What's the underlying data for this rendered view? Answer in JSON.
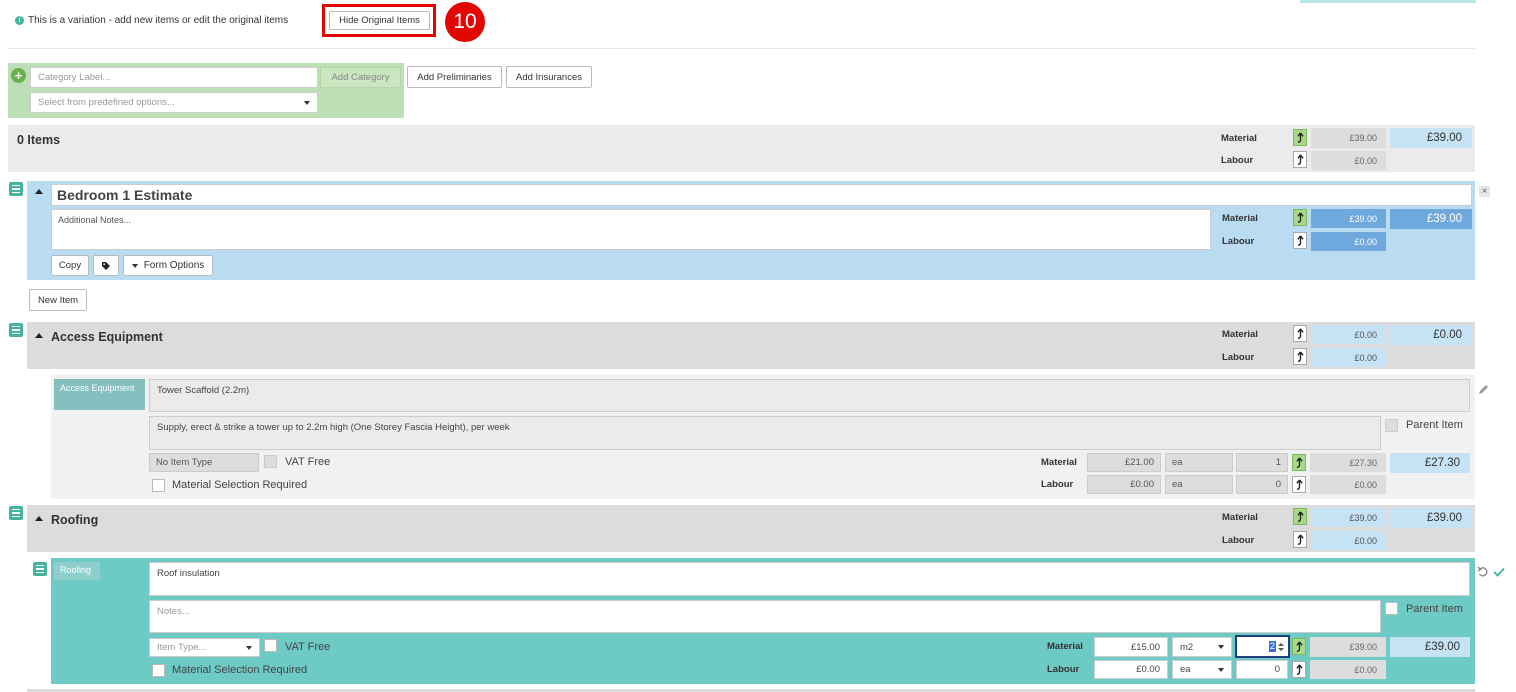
{
  "header": {
    "info_text": "This is a variation - add new items or edit the original items",
    "hide_button": "Hide Original Items",
    "step_badge": "10",
    "colors": {
      "accent": "#44b39d",
      "badge": "#e10600",
      "blue_row": "#b9dcf2",
      "teal": "#6ecac5"
    }
  },
  "category_form": {
    "label_placeholder": "Category Label...",
    "add_category": "Add Category",
    "predefined_placeholder": "Select from predefined options...",
    "add_preliminaries": "Add Preliminaries",
    "add_insurances": "Add Insurances"
  },
  "labels": {
    "material": "Material",
    "labour": "Labour"
  },
  "summary": {
    "title": "0 Items",
    "material_value": "£39.00",
    "labour_value": "£0.00",
    "total": "£39.00"
  },
  "estimate": {
    "title": "Bedroom 1 Estimate",
    "notes_placeholder": "Additional Notes...",
    "material_value": "£39.00",
    "labour_value": "£0.00",
    "total": "£39.00",
    "copy_button": "Copy",
    "form_options": "Form Options",
    "new_item": "New Item"
  },
  "access": {
    "title": "Access Equipment",
    "material_value": "£0.00",
    "labour_value": "£0.00",
    "total": "£0.00",
    "item": {
      "tag": "Access Equipment",
      "name": "Tower Scaffold (2.2m)",
      "description": "Supply, erect & strike a tower up to 2.2m high (One Storey Fascia Height), per week",
      "parent_item": "Parent Item",
      "item_type": "No Item Type",
      "vat_free": "VAT Free",
      "material_selection": "Material Selection Required",
      "material_price": "£21.00",
      "material_unit": "ea",
      "material_qty": "1",
      "material_value": "£27.30",
      "material_total": "£27.30",
      "labour_price": "£0.00",
      "labour_unit": "ea",
      "labour_qty": "0",
      "labour_value": "£0.00"
    }
  },
  "roofing": {
    "title": "Roofing",
    "material_value": "£39.00",
    "labour_value": "£0.00",
    "total": "£39.00",
    "item": {
      "tag": "Roofing",
      "name": "Roof insulation",
      "notes_placeholder": "Notes...",
      "parent_item": "Parent Item",
      "item_type_placeholder": "Item Type...",
      "vat_free": "VAT Free",
      "material_selection": "Material Selection Required",
      "material_price": "£15.00",
      "material_unit": "m2",
      "material_qty": "2",
      "material_value": "£39.00",
      "material_total": "£39.00",
      "labour_price": "£0.00",
      "labour_unit": "ea",
      "labour_qty": "0",
      "labour_value": "£0.00"
    }
  }
}
